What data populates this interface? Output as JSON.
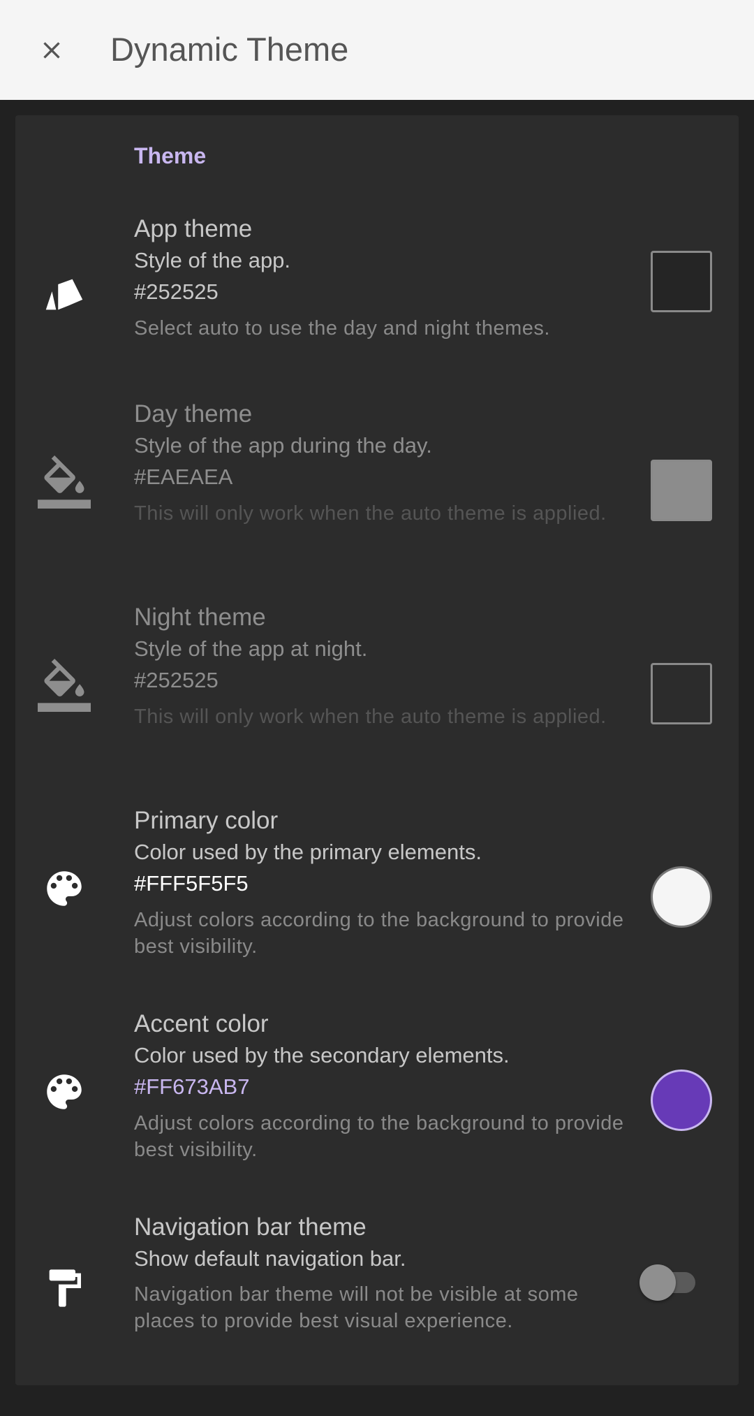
{
  "appbar": {
    "title": "Dynamic Theme",
    "close_icon": "close-icon"
  },
  "section": {
    "title": "Theme"
  },
  "colors": {
    "appbar_bg": "#F5F5F5",
    "card_bg": "#2C2C2C",
    "section_title": "#C9B7F0",
    "accent": "#673AB7",
    "primary": "#F5F5F5"
  },
  "items": [
    {
      "title": "App theme",
      "summary": "Style of the app.",
      "value": "#252525",
      "description": "Select auto to use the day and night themes.",
      "icon": "app-theme-icon",
      "swatch_color": "#252525",
      "enabled": true
    },
    {
      "title": "Day theme",
      "summary": "Style of the app during the day.",
      "value": "#EAEAEA",
      "description": "This will only work when the auto theme is applied.",
      "icon": "format-color-fill-icon",
      "swatch_color": "#8C8C8C",
      "enabled": false
    },
    {
      "title": "Night theme",
      "summary": "Style of the app at night.",
      "value": "#252525",
      "description": "This will only work when the auto theme is applied.",
      "icon": "format-color-fill-icon",
      "swatch_color": "#2C2C2C",
      "enabled": false
    },
    {
      "title": "Primary color",
      "summary": "Color used by the primary elements.",
      "value": "#FFF5F5F5",
      "description": "Adjust colors according to the background to provide best visibility.",
      "icon": "palette-icon",
      "swatch_color": "#F5F5F5",
      "value_color": "#FFFFFF",
      "enabled": true
    },
    {
      "title": "Accent color",
      "summary": "Color used by the secondary elements.",
      "value": "#FF673AB7",
      "description": "Adjust colors according to the background to provide best visibility.",
      "icon": "palette-icon",
      "swatch_color": "#673AB7",
      "value_color": "#C9B7F0",
      "enabled": true
    },
    {
      "title": "Navigation bar theme",
      "summary": "Show default navigation bar.",
      "description": "Navigation bar theme will not be visible at some places to provide best visual experience.",
      "icon": "format-paint-icon",
      "toggle_on": false,
      "enabled": true
    }
  ]
}
